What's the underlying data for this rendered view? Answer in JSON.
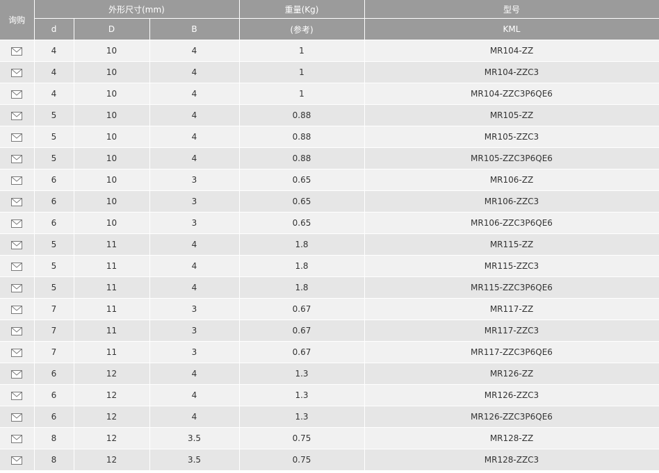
{
  "header": {
    "inquiry": "询购",
    "dimensions_group": "外形尺寸(mm)",
    "weight_group": "重量(Kg)",
    "model_group": "型号",
    "col_d": "d",
    "col_D": "D",
    "col_B": "B",
    "weight_ref": "(参考)",
    "brand": "KML"
  },
  "icons": {
    "inquiry_icon": "envelope-icon",
    "icon_color": "#777777"
  },
  "colors": {
    "header_bg": "#9b9b9b",
    "row_odd_bg": "#f1f1f1",
    "row_even_bg": "#e6e6e6"
  },
  "rows": [
    {
      "d": "4",
      "D": "10",
      "B": "4",
      "weight": "1",
      "model": "MR104-ZZ"
    },
    {
      "d": "4",
      "D": "10",
      "B": "4",
      "weight": "1",
      "model": "MR104-ZZC3"
    },
    {
      "d": "4",
      "D": "10",
      "B": "4",
      "weight": "1",
      "model": "MR104-ZZC3P6QE6"
    },
    {
      "d": "5",
      "D": "10",
      "B": "4",
      "weight": "0.88",
      "model": "MR105-ZZ"
    },
    {
      "d": "5",
      "D": "10",
      "B": "4",
      "weight": "0.88",
      "model": "MR105-ZZC3"
    },
    {
      "d": "5",
      "D": "10",
      "B": "4",
      "weight": "0.88",
      "model": "MR105-ZZC3P6QE6"
    },
    {
      "d": "6",
      "D": "10",
      "B": "3",
      "weight": "0.65",
      "model": "MR106-ZZ"
    },
    {
      "d": "6",
      "D": "10",
      "B": "3",
      "weight": "0.65",
      "model": "MR106-ZZC3"
    },
    {
      "d": "6",
      "D": "10",
      "B": "3",
      "weight": "0.65",
      "model": "MR106-ZZC3P6QE6"
    },
    {
      "d": "5",
      "D": "11",
      "B": "4",
      "weight": "1.8",
      "model": "MR115-ZZ"
    },
    {
      "d": "5",
      "D": "11",
      "B": "4",
      "weight": "1.8",
      "model": "MR115-ZZC3"
    },
    {
      "d": "5",
      "D": "11",
      "B": "4",
      "weight": "1.8",
      "model": "MR115-ZZC3P6QE6"
    },
    {
      "d": "7",
      "D": "11",
      "B": "3",
      "weight": "0.67",
      "model": "MR117-ZZ"
    },
    {
      "d": "7",
      "D": "11",
      "B": "3",
      "weight": "0.67",
      "model": "MR117-ZZC3"
    },
    {
      "d": "7",
      "D": "11",
      "B": "3",
      "weight": "0.67",
      "model": "MR117-ZZC3P6QE6"
    },
    {
      "d": "6",
      "D": "12",
      "B": "4",
      "weight": "1.3",
      "model": "MR126-ZZ"
    },
    {
      "d": "6",
      "D": "12",
      "B": "4",
      "weight": "1.3",
      "model": "MR126-ZZC3"
    },
    {
      "d": "6",
      "D": "12",
      "B": "4",
      "weight": "1.3",
      "model": "MR126-ZZC3P6QE6"
    },
    {
      "d": "8",
      "D": "12",
      "B": "3.5",
      "weight": "0.75",
      "model": "MR128-ZZ"
    },
    {
      "d": "8",
      "D": "12",
      "B": "3.5",
      "weight": "0.75",
      "model": "MR128-ZZC3"
    }
  ]
}
